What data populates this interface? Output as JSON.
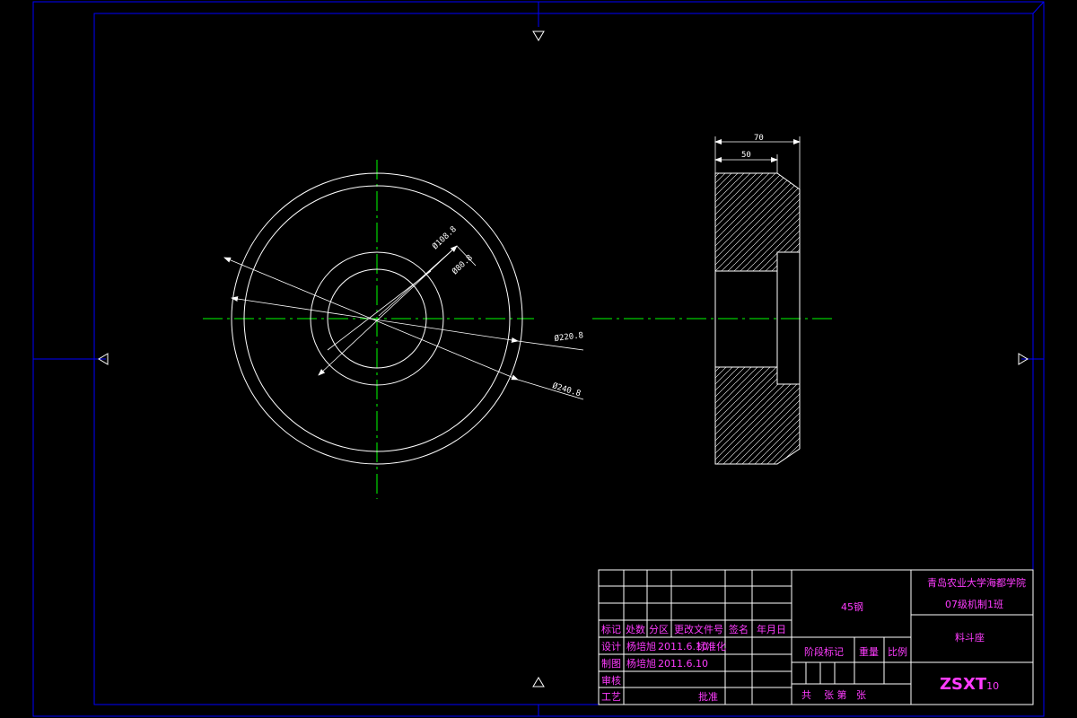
{
  "drawing": {
    "dimensions": {
      "d108": "Ø108.8",
      "d80": "Ø80.8",
      "d220": "Ø220.8",
      "d240": "Ø240.8",
      "w70": "70",
      "w50": "50"
    },
    "title_block": {
      "headers": [
        "标记",
        "处数",
        "分区",
        "更改文件号",
        "签名",
        "年月日"
      ],
      "design_label": "设计",
      "design_name": "杨培旭",
      "design_date": "2011.6.10",
      "standardize_label": "标准化",
      "drawing_label": "制图",
      "drawing_name": "杨培旭",
      "drawing_date": "2011.6.10",
      "review_label": "审核",
      "process_label": "工艺",
      "approve_label": "批准",
      "material": "45钢",
      "stage_mark_label": "阶段标记",
      "weight_label": "重量",
      "scale_label": "比例",
      "sheet_info": "共    张 第   张",
      "school_line1": "青岛农业大学海都学院",
      "school_line2": "07级机制1班",
      "part_name": "料斗座",
      "drawing_code": "ZSXT",
      "drawing_code_sub": "10"
    }
  },
  "colors": {
    "border": "#0000ff",
    "geometry": "#ffffff",
    "centerline": "#00ff00",
    "title_text": "#ff3cff",
    "background": "#000000"
  }
}
